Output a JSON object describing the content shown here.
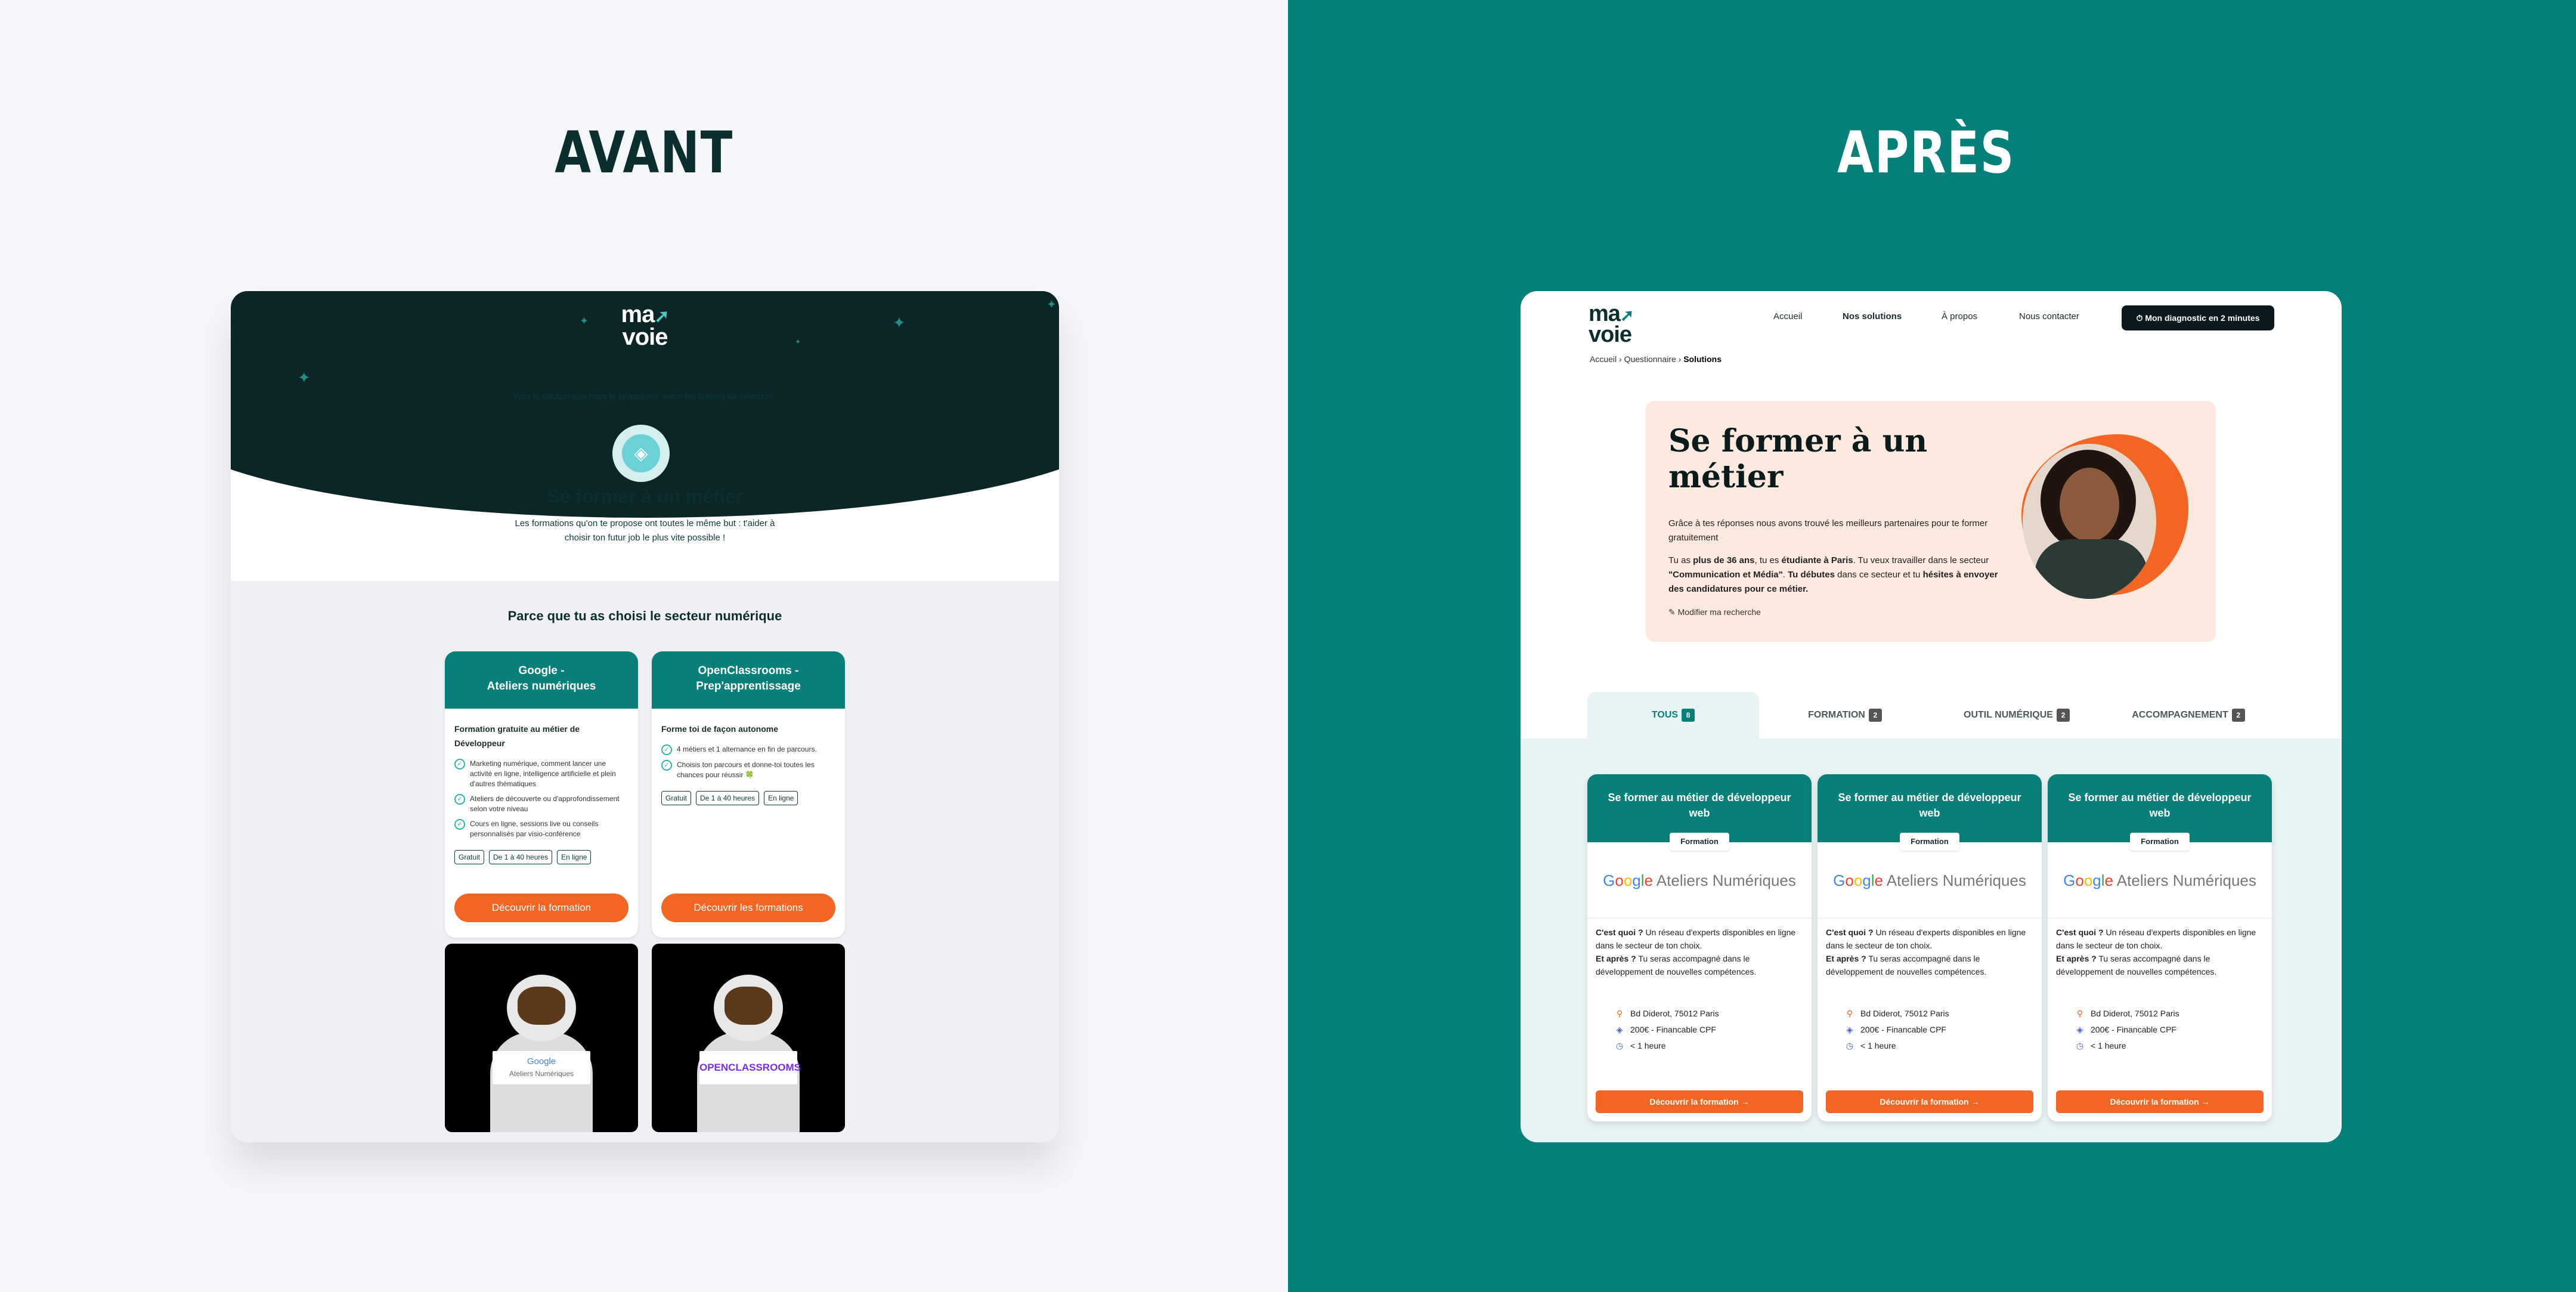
{
  "headings": {
    "left": "AVANT",
    "right": "APRÈS"
  },
  "avant": {
    "logo_top": "ma",
    "logo_bottom": "voie",
    "intro": "Voici la solution que nous te proposons, selon tes critères de sélection :",
    "title": "Se former à un métier",
    "description": "Les formations qu'on te propose ont toutes le même but : t'aider à choisir ton futur job le plus vite possible !",
    "section_title": "Parce que tu as choisi le secteur numérique",
    "cards": [
      {
        "title_line1": "Google -",
        "title_line2": "Ateliers numériques",
        "subtitle": "Formation gratuite au métier de Développeur",
        "bullets": [
          "Marketing numérique, comment lancer une activité en ligne, intelligence artificielle et plein d'autres thématiques",
          "Ateliers de découverte ou d'approfondissement selon votre niveau",
          "Cours en ligne, sessions live ou conseils personnalisés par visio-conférence"
        ],
        "tags": [
          "Gratuit",
          "De 1 à 40 heures",
          "En ligne"
        ],
        "button": "Découvrir la formation",
        "sign_line1": "Google",
        "sign_line2": "Ateliers Numériques"
      },
      {
        "title_line1": "OpenClassrooms -",
        "title_line2": "Prep'apprentissage",
        "subtitle": "Forme toi de façon autonome",
        "bullets": [
          "4 métiers et 1 alternance en fin de parcours.",
          "Choisis ton parcours et donne-toi toutes les chances pour réussir 🍀"
        ],
        "tags": [
          "Gratuit",
          "De 1 à 40 heures",
          "En ligne"
        ],
        "button": "Découvrir les formations",
        "sign_line1": "OPENCLASSROOMS"
      }
    ]
  },
  "apres": {
    "logo_top": "ma",
    "logo_bottom": "voie",
    "nav": [
      "Accueil",
      "Nos solutions",
      "À propos",
      "Nous contacter"
    ],
    "cta": "Mon diagnostic en 2 minutes",
    "breadcrumb": [
      "Accueil",
      "Questionnaire",
      "Solutions"
    ],
    "hero_title": "Se former à un métier",
    "hero_p1": "Grâce à tes réponses nous avons trouvé les meilleurs partenaires pour te former gratuitement",
    "hero_p2": {
      "a": "Tu as ",
      "b": "plus de 36 ans",
      "c": ", tu es ",
      "d": "étudiante à Paris",
      "e": ". Tu veux travailler dans le secteur ",
      "f": "\"Communication et Média\"",
      "g": ". ",
      "h": "Tu débutes",
      "i": " dans ce secteur et tu ",
      "j": "hésites à envoyer des candidatures pour ce métier."
    },
    "edit_link": "Modifier ma recherche",
    "tabs": [
      {
        "label": "TOUS",
        "count": "8"
      },
      {
        "label": "FORMATION",
        "count": "2"
      },
      {
        "label": "OUTIL NUMÉRIQUE",
        "count": "2"
      },
      {
        "label": "ACCOMPAGNEMENT",
        "count": "2"
      }
    ],
    "cards": [
      {
        "title": "Se former au métier de développeur web",
        "badge": "Formation",
        "brand_g": "Google",
        "brand_text": " Ateliers Numériques",
        "q1": "C'est quoi ?",
        "a1": " Un réseau d'experts disponibles en ligne dans le secteur de ton choix.",
        "q2": "Et après ?",
        "a2": " Tu seras accompagné dans le développement de nouvelles compétences.",
        "location": "Bd Diderot, 75012 Paris",
        "price": "200€ - Financable CPF",
        "duration": "< 1 heure",
        "button": "Découvrir la formation"
      },
      {
        "title": "Se former au métier de développeur web",
        "badge": "Formation",
        "brand_g": "Google",
        "brand_text": " Ateliers Numériques",
        "q1": "C'est quoi ?",
        "a1": " Un réseau d'experts disponibles en ligne dans le secteur de ton choix.",
        "q2": "Et après ?",
        "a2": " Tu seras accompagné dans le développement de nouvelles compétences.",
        "location": "Bd Diderot, 75012 Paris",
        "price": "200€ - Financable CPF",
        "duration": "< 1 heure",
        "button": "Découvrir la formation"
      },
      {
        "title": "Se former au métier de développeur web",
        "badge": "Formation",
        "brand_g": "Google",
        "brand_text": " Ateliers Numériques",
        "q1": "C'est quoi ?",
        "a1": " Un réseau d'experts disponibles en ligne dans le secteur de ton choix.",
        "q2": "Et après ?",
        "a2": " Tu seras accompagné dans le développement de nouvelles compétences.",
        "location": "Bd Diderot, 75012 Paris",
        "price": "200€ - Financable CPF",
        "duration": "< 1 heure",
        "button": "Découvrir la formation"
      }
    ]
  },
  "colors": {
    "teal": "#088079",
    "orange": "#f26522",
    "dark": "#0c2628",
    "peach": "#fde9dd"
  },
  "icons": {
    "check": "check-icon",
    "edit": "edit-icon",
    "location": "location-pin-icon",
    "price": "tag-icon",
    "duration": "clock-icon",
    "arrow": "arrow-right-icon"
  }
}
